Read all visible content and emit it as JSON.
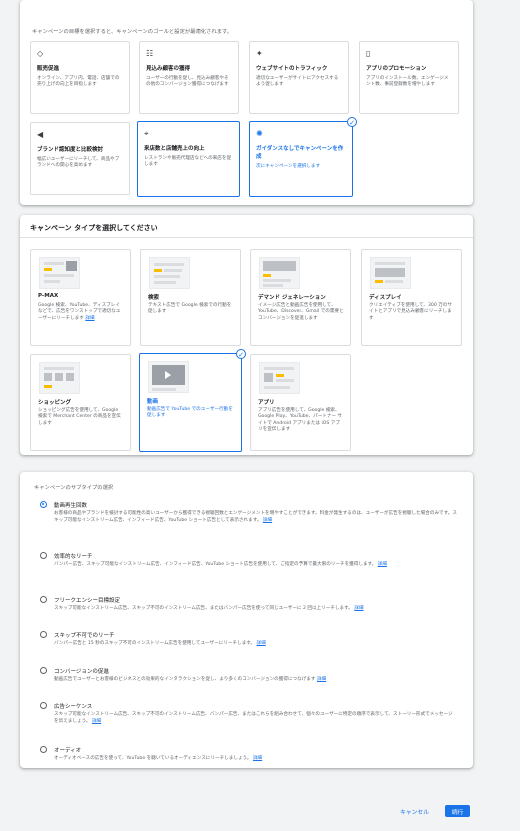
{
  "goals": {
    "hint": "キャンペーンの目標を選択すると、キャンペーンのゴールと設定が最適化されます。",
    "items": [
      {
        "icon": "tag-icon",
        "glyph": "◇",
        "title": "販売促進",
        "desc": "オンライン、アプリ内、電話、店舗での売り上げの向上を目指します"
      },
      {
        "icon": "people-icon",
        "glyph": "☷",
        "title": "見込み顧客の獲得",
        "desc": "ユーザーの行動を促し、見込み顧客やその他のコンバージョン獲得につなげます"
      },
      {
        "icon": "cursor-click-icon",
        "glyph": "✦",
        "title": "ウェブサイトのトラフィック",
        "desc": "適切なユーザーがサイトにアクセスするよう促します"
      },
      {
        "icon": "mobile-phone-icon",
        "glyph": "▯",
        "title": "アプリのプロモーション",
        "desc": "アプリのインストール数、エンゲージメント数、事前登録数を増やします"
      },
      {
        "icon": "megaphone-icon",
        "glyph": "◀",
        "title": "ブランド認知度と比較検討",
        "desc": "幅広いユーザーにリーチして、商品やブランドへの関心を高めます"
      },
      {
        "icon": "location-pin-icon",
        "glyph": "⌖",
        "title": "来店数と店舗売上の向上",
        "desc": "レストランや販売代理店などへの来店を促します"
      },
      {
        "icon": "gear-icon",
        "glyph": "✺",
        "title": "ガイダンスなしでキャンペーンを作成",
        "desc": "次にキャンペーンを選択します"
      }
    ]
  },
  "types": {
    "title": "キャンペーン タイプを選択してください",
    "items": [
      {
        "title": "P-MAX",
        "desc": "Google 検索、YouTube、ディスプレイなどで、広告をワンストップで適切なユーザーにリーチします",
        "link": "詳細"
      },
      {
        "title": "検索",
        "desc": "テキスト広告で Google 検索での行動を促します",
        "link": ""
      },
      {
        "title": "デマンド ジェネレーション",
        "desc": "イメージ広告と動画広告を使用して、YouTube、Discover、Gmail での需要とコンバージョンを促進します",
        "link": ""
      },
      {
        "title": "ディスプレイ",
        "desc": "クリエイティブを使用して、300 万のサイトとアプリで見込み顧客にリーチします",
        "link": ""
      },
      {
        "title": "ショッピング",
        "desc": "ショッピング広告を使用して、Google 検索で Merchant Center の商品を宣伝します",
        "link": ""
      },
      {
        "title": "動画",
        "desc": "動画広告で YouTube でのユーザー行動を促します",
        "link": ""
      },
      {
        "title": "アプリ",
        "desc": "アプリ広告を使用して、Google 検索、Google Play、YouTube、パートナー サイトで Android アプリまたは iOS アプリを宣伝します",
        "link": ""
      }
    ]
  },
  "subtypes": {
    "title": "キャンペーンのサブタイプの選択",
    "items": [
      {
        "title": "動画再生回数",
        "desc": "お客様の商品やブランドを検討する可能性の高いユーザーから獲得できる視聴回数とエンゲージメントを増やすことができます。料金が発生するのは、ユーザーが広告を視聴した場合のみです。スキップ可能なインストリーム広告、インフィード広告、YouTube ショート広告として表示されます。",
        "link": "詳細"
      },
      {
        "title": "効率的なリーチ",
        "desc": "バンパー広告、スキップ可能なインストリーム広告、インフィード広告、YouTube ショート広告を使用して、ご指定の予算で最大限のリーチを獲得します。",
        "link": "詳細"
      },
      {
        "title": "フリークエンシー目標設定",
        "desc": "スキップ可能なインストリーム広告、スキップ不可のインストリーム広告、またはバンパー広告を使って同じユーザーに 2 回以上リーチします。",
        "link": "詳細"
      },
      {
        "title": "スキップ不可でのリーチ",
        "desc": "バンパー広告と 15 秒のスキップ不可のインストリーム広告を使用してユーザーにリーチします。",
        "link": "詳細"
      },
      {
        "title": "コンバージョンの促進",
        "desc": "動画広告でユーザーとお客様のビジネスとの効果的なインタラクションを促し、より多くのコンバージョンの獲得につなげます",
        "link": "詳細"
      },
      {
        "title": "広告シーケンス",
        "desc": "スキップ可能なインストリーム広告、スキップ不可のインストリーム広告、バンパー広告、またはこれらを組み合わせて、個々のユーザーに特定の順序で表示して、ストーリー形式でメッセージを伝えましょう。",
        "link": "詳細"
      },
      {
        "title": "オーディオ",
        "desc": "オーディオベースの広告を使って、YouTube を聴いているオーディエンスにリーチしましょう。",
        "link": "詳細"
      }
    ]
  },
  "footer": {
    "cancel_label": "キャンセル",
    "next_label": "続行"
  }
}
